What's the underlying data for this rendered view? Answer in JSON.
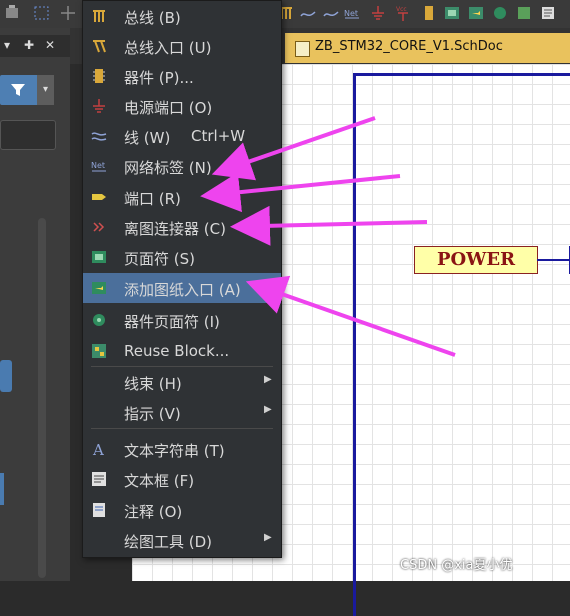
{
  "document_tab": {
    "title": "ZB_STM32_CORE_V1.SchDoc"
  },
  "canvas": {
    "port_label": "POWER"
  },
  "menu": {
    "items": [
      {
        "label": "总线 (B)",
        "icon": "bus-icon"
      },
      {
        "label": "总线入口 (U)",
        "icon": "bus-entry-icon"
      },
      {
        "label": "器件 (P)...",
        "icon": "part-icon"
      },
      {
        "label": "电源端口 (O)",
        "icon": "power-port-icon"
      },
      {
        "label": "线 (W)",
        "shortcut": "Ctrl+W",
        "icon": "wire-icon"
      },
      {
        "label": "网络标签 (N)",
        "icon": "net-label-icon"
      },
      {
        "label": "端口 (R)",
        "icon": "port-icon"
      },
      {
        "label": "离图连接器 (C)",
        "icon": "off-sheet-connector-icon"
      },
      {
        "label": "页面符 (S)",
        "icon": "sheet-symbol-icon"
      },
      {
        "label": "添加图纸入口 (A)",
        "icon": "sheet-entry-icon",
        "highlighted": true
      },
      {
        "label": "器件页面符 (I)",
        "icon": "device-sheet-symbol-icon"
      },
      {
        "label": "Reuse Block...",
        "icon": "reuse-block-icon"
      },
      {
        "label": "线束 (H)",
        "icon": "",
        "submenu": true
      },
      {
        "label": "指示 (V)",
        "icon": "",
        "submenu": true
      },
      {
        "label": "文本字符串 (T)",
        "icon": "text-string-icon"
      },
      {
        "label": "文本框 (F)",
        "icon": "text-frame-icon"
      },
      {
        "label": "注释 (O)",
        "icon": "note-icon"
      },
      {
        "label": "绘图工具 (D)",
        "icon": "",
        "submenu": true
      }
    ]
  },
  "colors": {
    "menu_bg": "#2f3235",
    "menu_highlight": "#4b6f9b",
    "annotation_arrow": "#ee44ee",
    "sheet_border": "#1a1a9e",
    "tab_bg": "#e9c25d"
  },
  "watermark": "CSDN @xia夏小优"
}
